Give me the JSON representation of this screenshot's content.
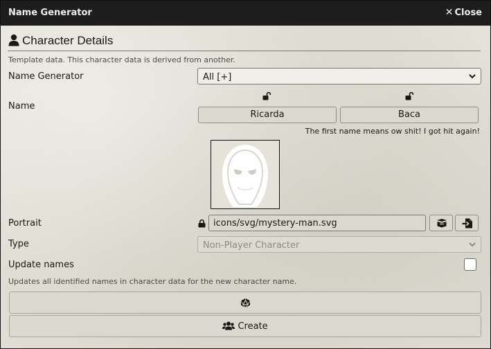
{
  "window": {
    "title": "Name Generator",
    "close_label": "Close"
  },
  "section": {
    "heading": "Character Details",
    "template_note": "Template data. This character data is derived from another."
  },
  "name_generator": {
    "label": "Name Generator",
    "selected": "All [+]"
  },
  "name": {
    "label": "Name",
    "first": "Ricarda",
    "last": "Baca",
    "meaning": "The first name means ow shit! I got hit again!"
  },
  "portrait": {
    "label": "Portrait",
    "path": "icons/svg/mystery-man.svg"
  },
  "type": {
    "label": "Type",
    "selected": "Non-Player Character"
  },
  "update_names": {
    "label": "Update names",
    "checked": false,
    "note": "Updates all identified names in character data for the new character name."
  },
  "buttons": {
    "create_label": "Create"
  },
  "icons": {
    "person": "user-icon",
    "lock_open": "unlock-icon",
    "lock": "lock-icon",
    "box": "box-open-icon",
    "file_import": "file-import-icon",
    "d20": "d20-icon",
    "users": "users-icon",
    "chevron": "chevron-down-icon",
    "close": "close-icon"
  },
  "colors": {
    "titlebar": "#1d1d1d",
    "panel": "#e4e2d9",
    "button": "#dad8cf",
    "text": "#191813"
  }
}
